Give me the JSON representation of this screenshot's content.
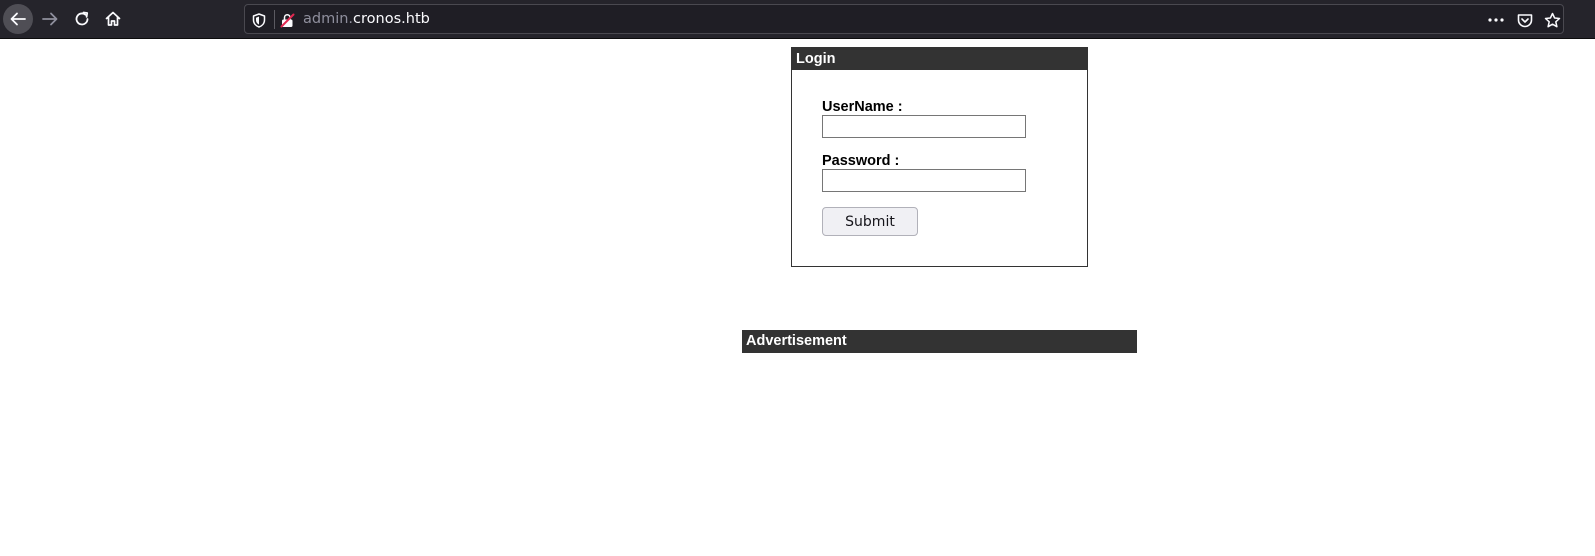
{
  "browser": {
    "url_subdomain": "admin.",
    "url_domain": "cronos.htb",
    "icons": {
      "back": "arrow-left-icon",
      "forward": "arrow-right-icon",
      "reload": "reload-icon",
      "home": "home-icon",
      "tracking": "shield-icon",
      "insecure": "insecure-lock-icon",
      "more": "more-dots-icon",
      "pocket": "pocket-icon",
      "bookmark": "star-icon"
    },
    "colors": {
      "toolbar_bg": "#25242b",
      "urlbar_bg": "#1f1e25",
      "url_text": "#fbfbfe",
      "url_subdomain_text": "#8f8f9d",
      "insecure_icon": "#e22850"
    }
  },
  "login": {
    "title": "Login",
    "username_label": "UserName :",
    "username_value": "",
    "password_label": "Password :",
    "password_value": "",
    "submit_label": "Submit"
  },
  "advertisement": {
    "title": "Advertisement"
  },
  "colors": {
    "header_bg": "#333333",
    "header_text": "#ffffff"
  }
}
